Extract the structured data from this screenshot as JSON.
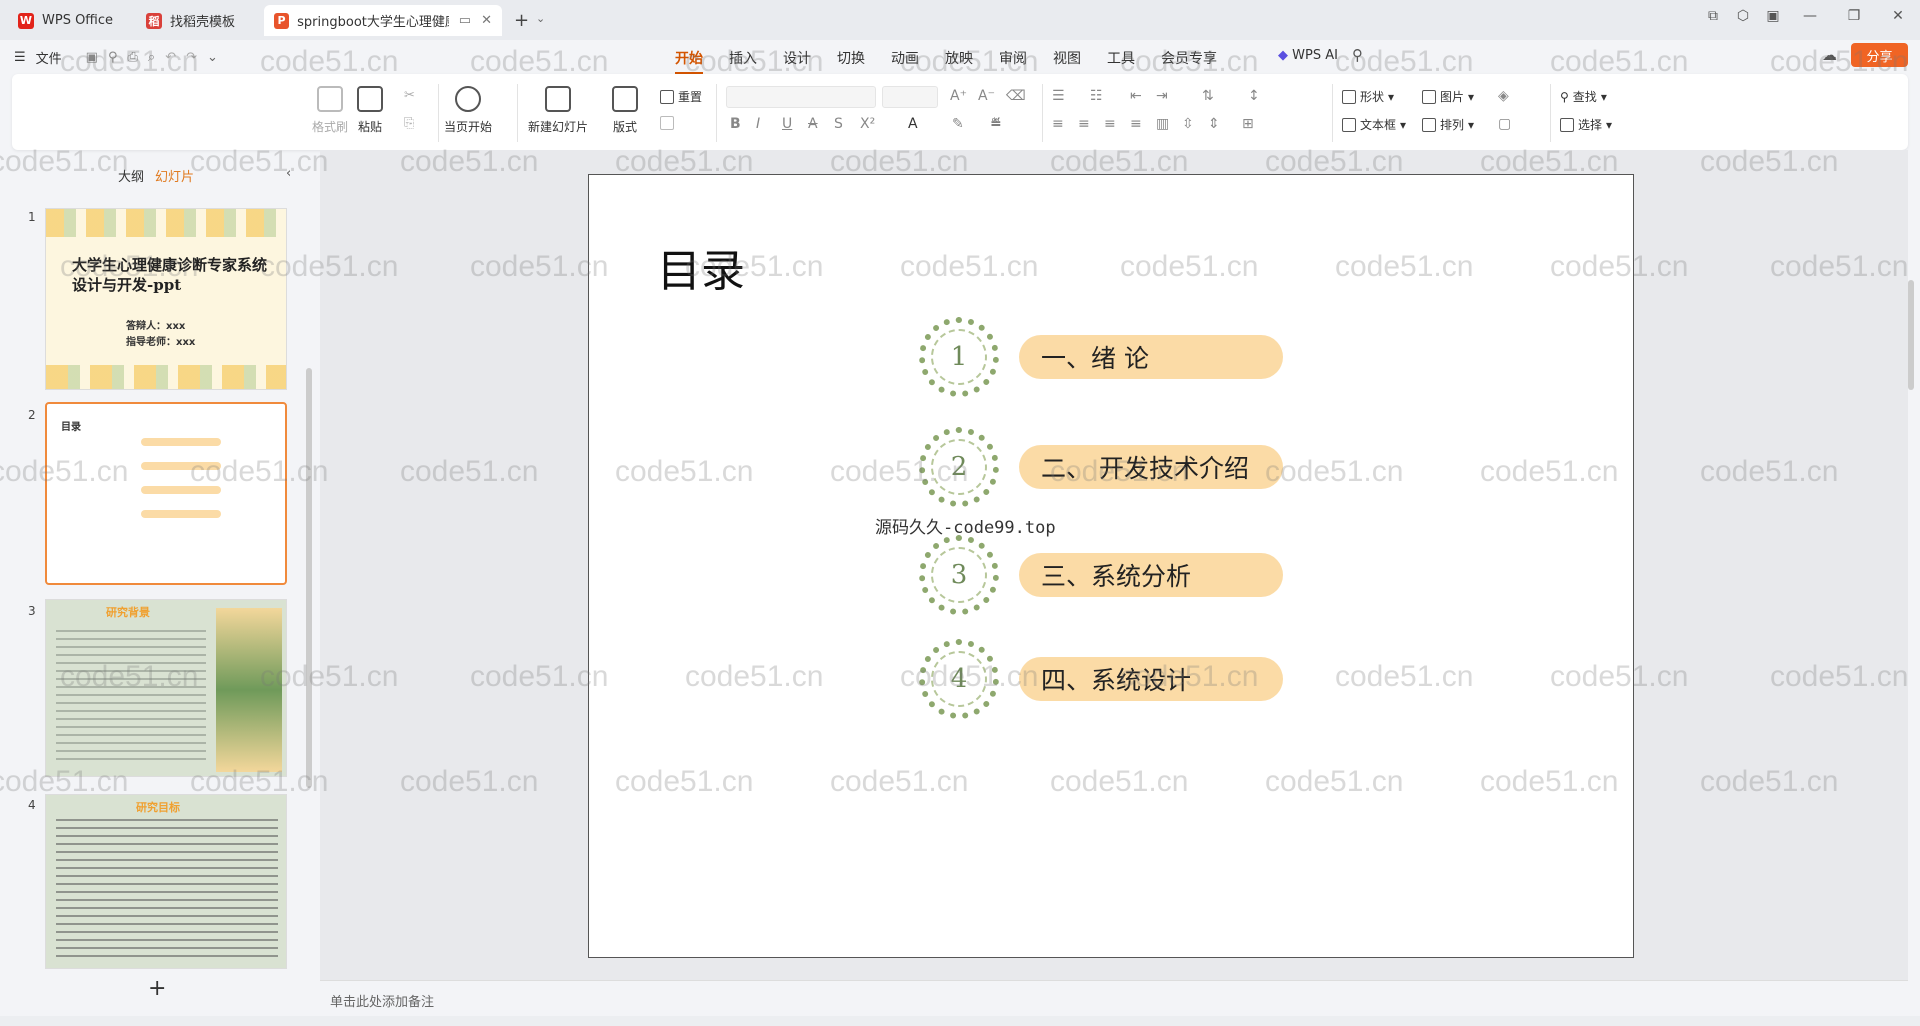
{
  "tabs": [
    {
      "label": "WPS Office",
      "icon": "wps-logo-icon",
      "color": "#e2231a"
    },
    {
      "label": "找稻壳模板",
      "icon": "docer-icon",
      "color": "#d9403a"
    },
    {
      "label": "springboot大学生心理健康",
      "icon": "ppt-icon",
      "color": "#e8542c"
    }
  ],
  "menu": {
    "file": "文件",
    "tabs": [
      "开始",
      "插入",
      "设计",
      "切换",
      "动画",
      "放映",
      "审阅",
      "视图",
      "工具",
      "会员专享"
    ],
    "active_tab": "开始",
    "wps_ai": "WPS AI",
    "share": "分享"
  },
  "ribbon": {
    "format_painter": "格式刷",
    "paste": "粘贴",
    "start_show": "当页开始",
    "new_slide": "新建幻灯片",
    "layout": "版式",
    "reset": "重置",
    "shape": "形状",
    "picture": "图片",
    "find": "查找",
    "textbox": "文本框",
    "arrange": "排列",
    "select": "选择"
  },
  "sidebar": {
    "outline": "大纲",
    "slides": "幻灯片"
  },
  "thumbnails": [
    {
      "num": "1",
      "title": "大学生心理健康诊断专家系统设计与开发-ppt",
      "line1": "答辩人：xxx",
      "line2": "指导老师：xxx"
    },
    {
      "num": "2",
      "title": "目录"
    },
    {
      "num": "3",
      "title": "研究背景"
    },
    {
      "num": "4",
      "title": "研究目标"
    }
  ],
  "slide": {
    "title": "目录",
    "items": [
      {
        "num": "1",
        "label": "一、绪  论"
      },
      {
        "num": "2",
        "label": "二、 开发技术介绍"
      },
      {
        "num": "3",
        "label": "三、系统分析"
      },
      {
        "num": "4",
        "label": "四、系统设计"
      }
    ],
    "overlay_text": "源码久久-code99.top"
  },
  "notes_placeholder": "单击此处添加备注",
  "watermark_text": "code51.cn"
}
